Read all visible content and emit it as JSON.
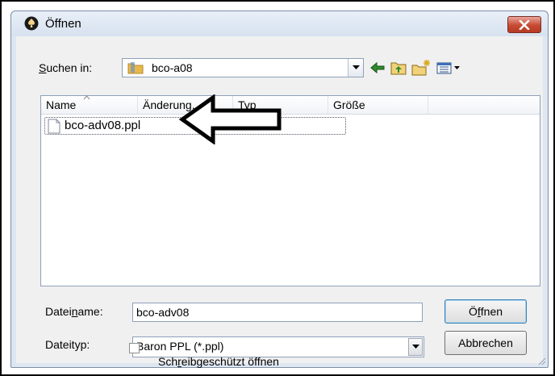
{
  "window": {
    "title": "Öffnen",
    "icon": "spade-app-icon",
    "close_icon": "close-icon"
  },
  "toolbar": {
    "look_in_label_u": "S",
    "look_in_label_rest": "uchen in:",
    "look_in_value": "bco-a08",
    "buttons": [
      "back-arrow-icon",
      "up-folder-icon",
      "new-folder-icon",
      "view-menu-icon"
    ]
  },
  "list": {
    "columns": [
      "Name",
      "Änderung...",
      "Typ",
      "Größe"
    ],
    "files": [
      {
        "name": "bco-adv08.ppl",
        "icon": "file-icon"
      }
    ]
  },
  "annotation": {
    "icon": "pointer-arrow-icon"
  },
  "filename": {
    "label_pre": "Datei",
    "label_u": "n",
    "label_post": "ame:",
    "value": "bco-adv08"
  },
  "filetype": {
    "label": "Dateityp:",
    "value": "Baron PPL (*.ppl)"
  },
  "readonly": {
    "label_pre": "Sch",
    "label_u": "r",
    "label_post": "eibgeschützt öffnen",
    "checked": false
  },
  "buttons": {
    "open_pre": "Ö",
    "open_u": "f",
    "open_post": "fnen",
    "cancel": "Abbrechen"
  },
  "colors": {
    "dialog_bg": "#f0f0f0",
    "frame": "#dde6f1",
    "close_red": "#c74a33",
    "folder_yellow": "#e8b84a"
  }
}
